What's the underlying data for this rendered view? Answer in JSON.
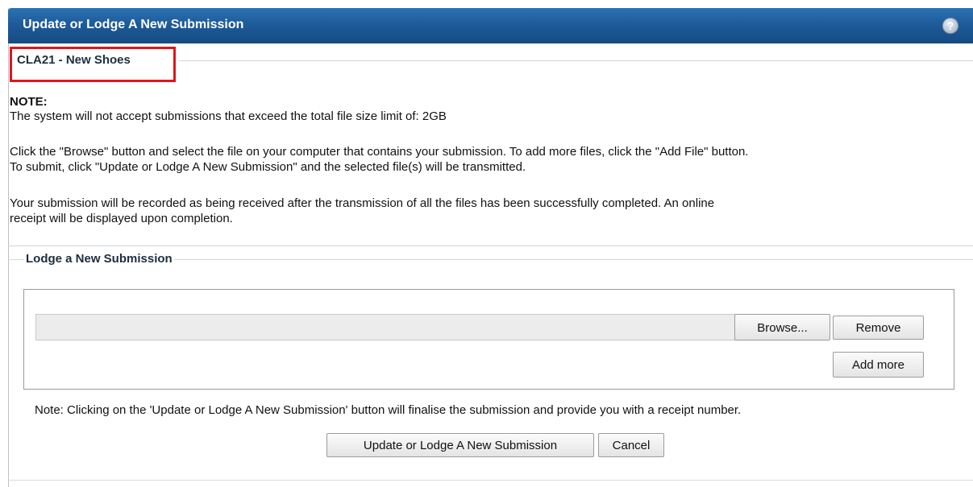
{
  "header": {
    "title": "Update or Lodge A New Submission",
    "help_icon": "?"
  },
  "case_section": {
    "legend": "CLA21 - New Shoes"
  },
  "note": {
    "heading": "NOTE:",
    "limit_text": "The system will not accept submissions that exceed the total file size limit of: 2GB",
    "browse_line1": "Click the \"Browse\" button and select the file on your computer that contains your submission. To add more files, click the \"Add File\" button.",
    "browse_line2": "To submit, click \"Update or Lodge A New Submission\" and the selected file(s) will be transmitted.",
    "receipt_line1": "Your submission will be recorded as being received after the transmission of all the files has been successfully completed. An online",
    "receipt_line2": "receipt will be displayed upon completion."
  },
  "lodge_section": {
    "legend": "Lodge a New Submission",
    "file_input_value": "",
    "browse_label": "Browse...",
    "remove_label": "Remove",
    "add_more_label": "Add more",
    "final_note": "Note: Clicking on the 'Update or Lodge A New Submission' button will finalise the submission and provide you with a receipt number.",
    "submit_label": "Update or Lodge A New Submission",
    "cancel_label": "Cancel"
  },
  "colors": {
    "header_bg": "#1d5b9a",
    "highlight_border": "#e0141a"
  }
}
